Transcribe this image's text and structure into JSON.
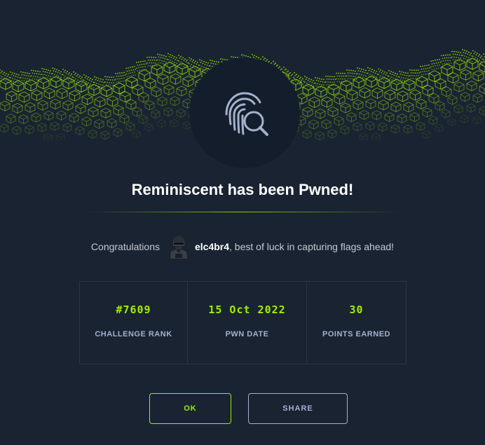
{
  "dialog": {
    "title": "Reminiscent has been Pwned!",
    "badge_icon": "fingerprint-search-icon"
  },
  "congrats": {
    "prefix": "Congratulations",
    "username": "elc4br4",
    "suffix": ", best of luck in capturing flags ahead!",
    "avatar_icon": "hacker-avatar-icon"
  },
  "stats": [
    {
      "value": "#7609",
      "label": "CHALLENGE RANK"
    },
    {
      "value": "15 Oct 2022",
      "label": "PWN DATE"
    },
    {
      "value": "30",
      "label": "POINTS EARNED"
    }
  ],
  "buttons": {
    "ok_label": "OK",
    "share_label": "SHARE"
  },
  "colors": {
    "background": "#1a2332",
    "accent": "#9fef00",
    "badge_bg": "#141d2b",
    "text_muted": "#a4b1cd"
  }
}
